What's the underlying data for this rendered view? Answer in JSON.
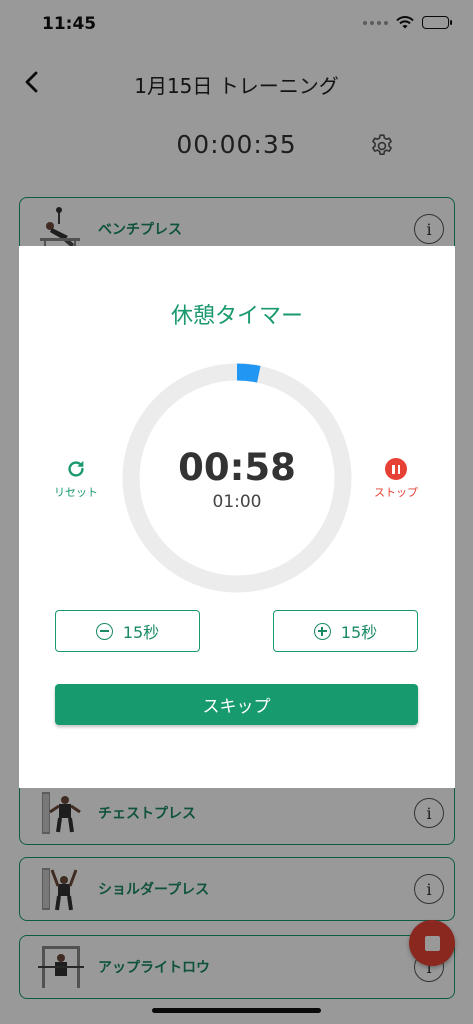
{
  "status_bar": {
    "time": "11:45"
  },
  "nav": {
    "title": "1月15日 トレーニング"
  },
  "workout": {
    "elapsed": "00:00:35"
  },
  "exercises": [
    {
      "name": "ベンチプレス",
      "info": "i"
    },
    {
      "name": "チェストプレス",
      "info": "i"
    },
    {
      "name": "ショルダープレス",
      "info": "i"
    },
    {
      "name": "アップライトロウ",
      "info": "i"
    }
  ],
  "rest_timer": {
    "title": "休憩タイマー",
    "remaining": "00:58",
    "total": "01:00",
    "progress_remaining_fraction": 0.967,
    "reset_label": "リセット",
    "stop_label": "ストップ",
    "minus_label": "15秒",
    "plus_label": "15秒",
    "skip_label": "スキップ"
  },
  "colors": {
    "accent": "#1a9a6c",
    "danger": "#e64134",
    "progress": "#2196f3",
    "ring_track": "#ececec"
  }
}
